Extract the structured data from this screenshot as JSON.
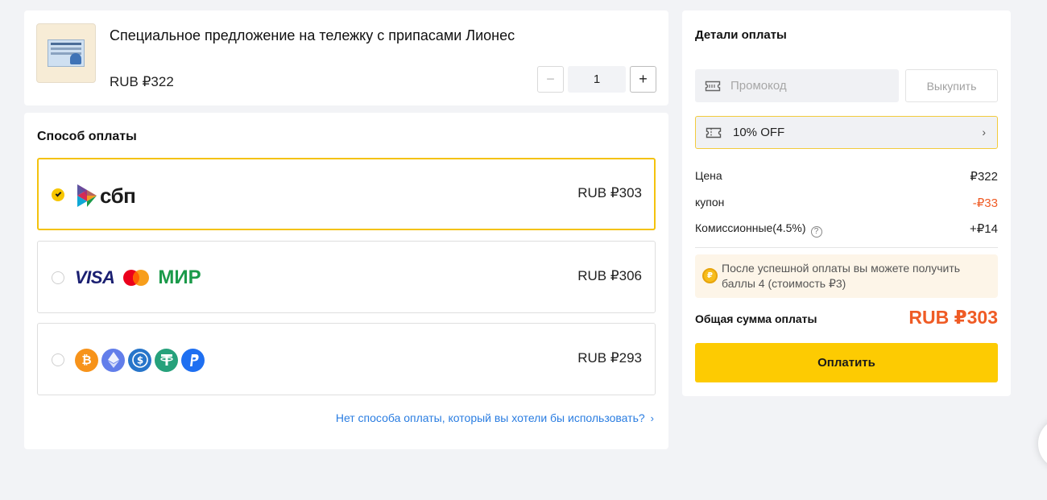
{
  "product": {
    "title": "Специальное предложение на тележку с припасами Лионес",
    "price": "RUB ₽322",
    "quantity": "1",
    "minus_label": "−",
    "plus_label": "+"
  },
  "methods": {
    "title": "Способ оплаты",
    "sbp": {
      "logo_text": "сбп",
      "price": "RUB ₽303",
      "selected": true
    },
    "cards": {
      "visa_text": "VISA",
      "mir_text": "МИР",
      "price": "RUB ₽306",
      "selected": false
    },
    "crypto": {
      "icons": [
        "bitcoin-icon",
        "ethereum-icon",
        "usdc-icon",
        "tether-icon",
        "paypal-icon"
      ],
      "price": "RUB ₽293",
      "selected": false
    },
    "no_method_link": "Нет способа оплаты, который вы хотели бы использовать?"
  },
  "details": {
    "title": "Детали оплаты",
    "promo_placeholder": "Промокод",
    "redeem_label": "Выкупить",
    "coupon_label": "10% OFF",
    "price_label": "Цена",
    "price_value": "₽322",
    "coupon_row_label": "купон",
    "coupon_value": "-₽33",
    "commission_label": "Комиссионные(4.5%)",
    "commission_value": "+₽14",
    "points_text": "После успешной оплаты вы можете получить баллы 4 (стоимость ₽3)",
    "total_label": "Общая сумма оплаты",
    "total_value": "RUB ₽303",
    "pay_label": "Оплатить"
  },
  "colors": {
    "accent": "#fdcb02",
    "selected_border": "#f4c20d",
    "negative": "#ef5b25",
    "link": "#2a7de1"
  }
}
